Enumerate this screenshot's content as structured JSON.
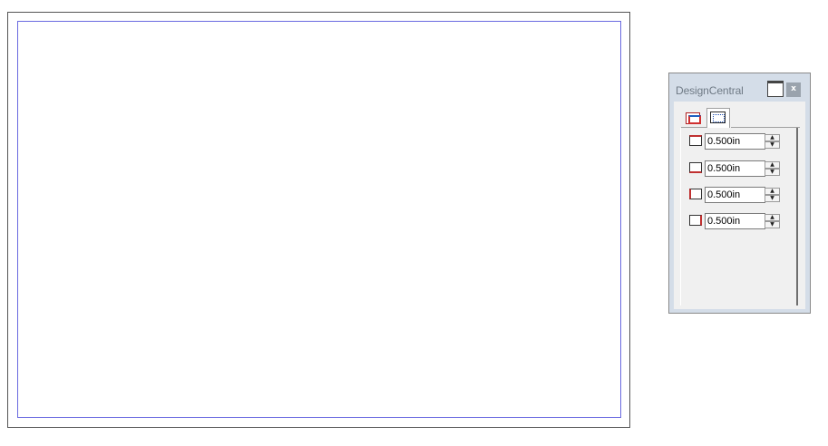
{
  "palette": {
    "title": "DesignCentral",
    "close_glyph": "x",
    "tabs": [
      {
        "icon": "page-layout-icon"
      },
      {
        "icon": "margins-icon"
      }
    ],
    "margins": [
      {
        "side": "top",
        "value": "0.500in"
      },
      {
        "side": "bottom",
        "value": "0.500in"
      },
      {
        "side": "left",
        "value": "0.500in"
      },
      {
        "side": "right",
        "value": "0.500in"
      }
    ],
    "spin_up_glyph": "▲",
    "spin_down_glyph": "▼"
  },
  "colors": {
    "margin_guide": "#6a6ae0",
    "margin_edge": "#c03030"
  }
}
